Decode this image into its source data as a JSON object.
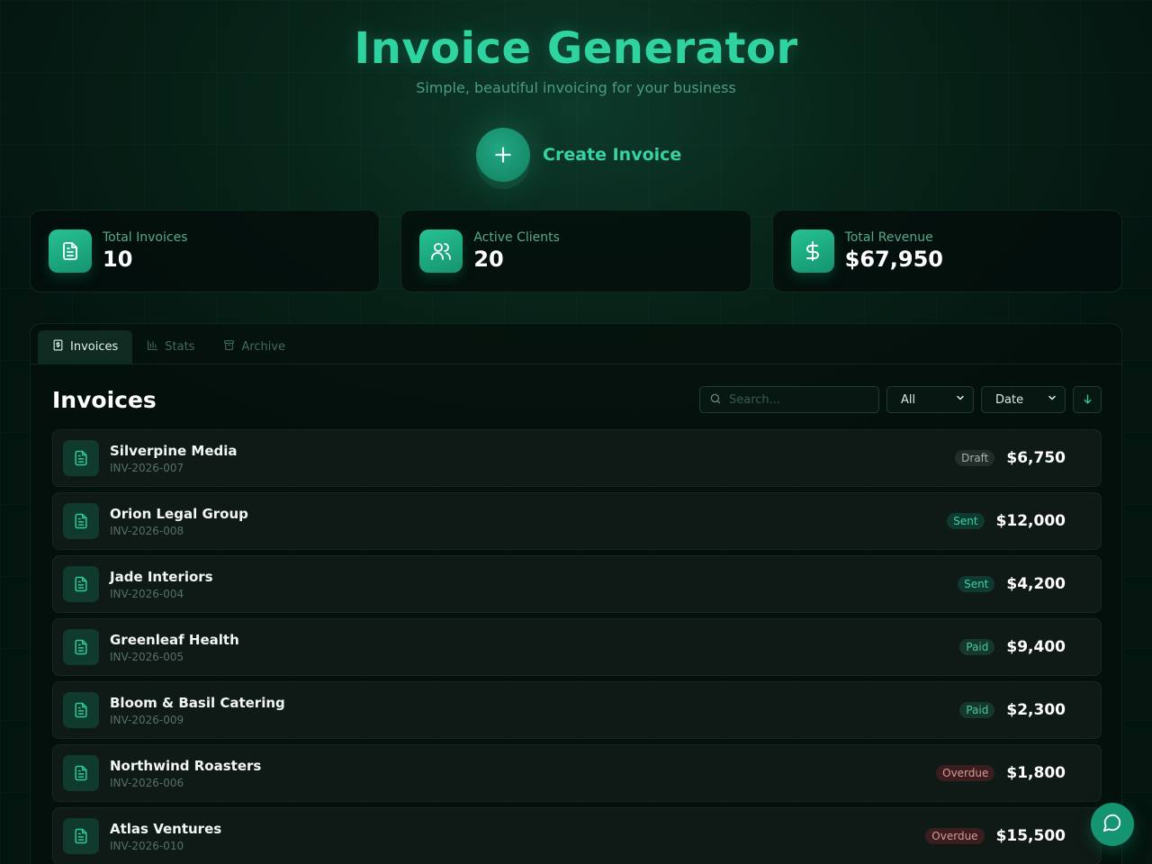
{
  "header": {
    "title": "Invoice Generator",
    "subtitle": "Simple, beautiful invoicing for your business"
  },
  "create": {
    "label": "Create Invoice",
    "icon": "plus-icon"
  },
  "stats": [
    {
      "label": "Total Invoices",
      "value": "10",
      "icon": "document-icon"
    },
    {
      "label": "Active Clients",
      "value": "20",
      "icon": "users-icon"
    },
    {
      "label": "Total Revenue",
      "value": "$67,950",
      "icon": "dollar-icon"
    }
  ],
  "tabs": [
    {
      "label": "Invoices",
      "icon": "invoice-icon",
      "active": true
    },
    {
      "label": "Stats",
      "icon": "bar-chart-icon",
      "active": false
    },
    {
      "label": "Archive",
      "icon": "archive-icon",
      "active": false
    }
  ],
  "list": {
    "title": "Invoices",
    "search_placeholder": "Search...",
    "filter_selected": "All",
    "sort_selected": "Date",
    "sort_direction_icon": "arrow-down-icon"
  },
  "invoices": [
    {
      "client": "Silverpine Media",
      "number": "INV-2026-007",
      "status": "Draft",
      "amount": "$6,750"
    },
    {
      "client": "Orion Legal Group",
      "number": "INV-2026-008",
      "status": "Sent",
      "amount": "$12,000"
    },
    {
      "client": "Jade Interiors",
      "number": "INV-2026-004",
      "status": "Sent",
      "amount": "$4,200"
    },
    {
      "client": "Greenleaf Health",
      "number": "INV-2026-005",
      "status": "Paid",
      "amount": "$9,400"
    },
    {
      "client": "Bloom & Basil Catering",
      "number": "INV-2026-009",
      "status": "Paid",
      "amount": "$2,300"
    },
    {
      "client": "Northwind Roasters",
      "number": "INV-2026-006",
      "status": "Overdue",
      "amount": "$1,800"
    },
    {
      "client": "Atlas Ventures",
      "number": "INV-2026-010",
      "status": "Overdue",
      "amount": "$15,500"
    }
  ],
  "colors": {
    "accent": "#2ed3a0",
    "background": "#041510",
    "status_draft": "#9fb4ac",
    "status_sent": "#3fd1a4",
    "status_paid": "#46c99b",
    "status_overdue": "#d79a9a"
  },
  "chat": {
    "icon": "chat-bubble-icon"
  }
}
